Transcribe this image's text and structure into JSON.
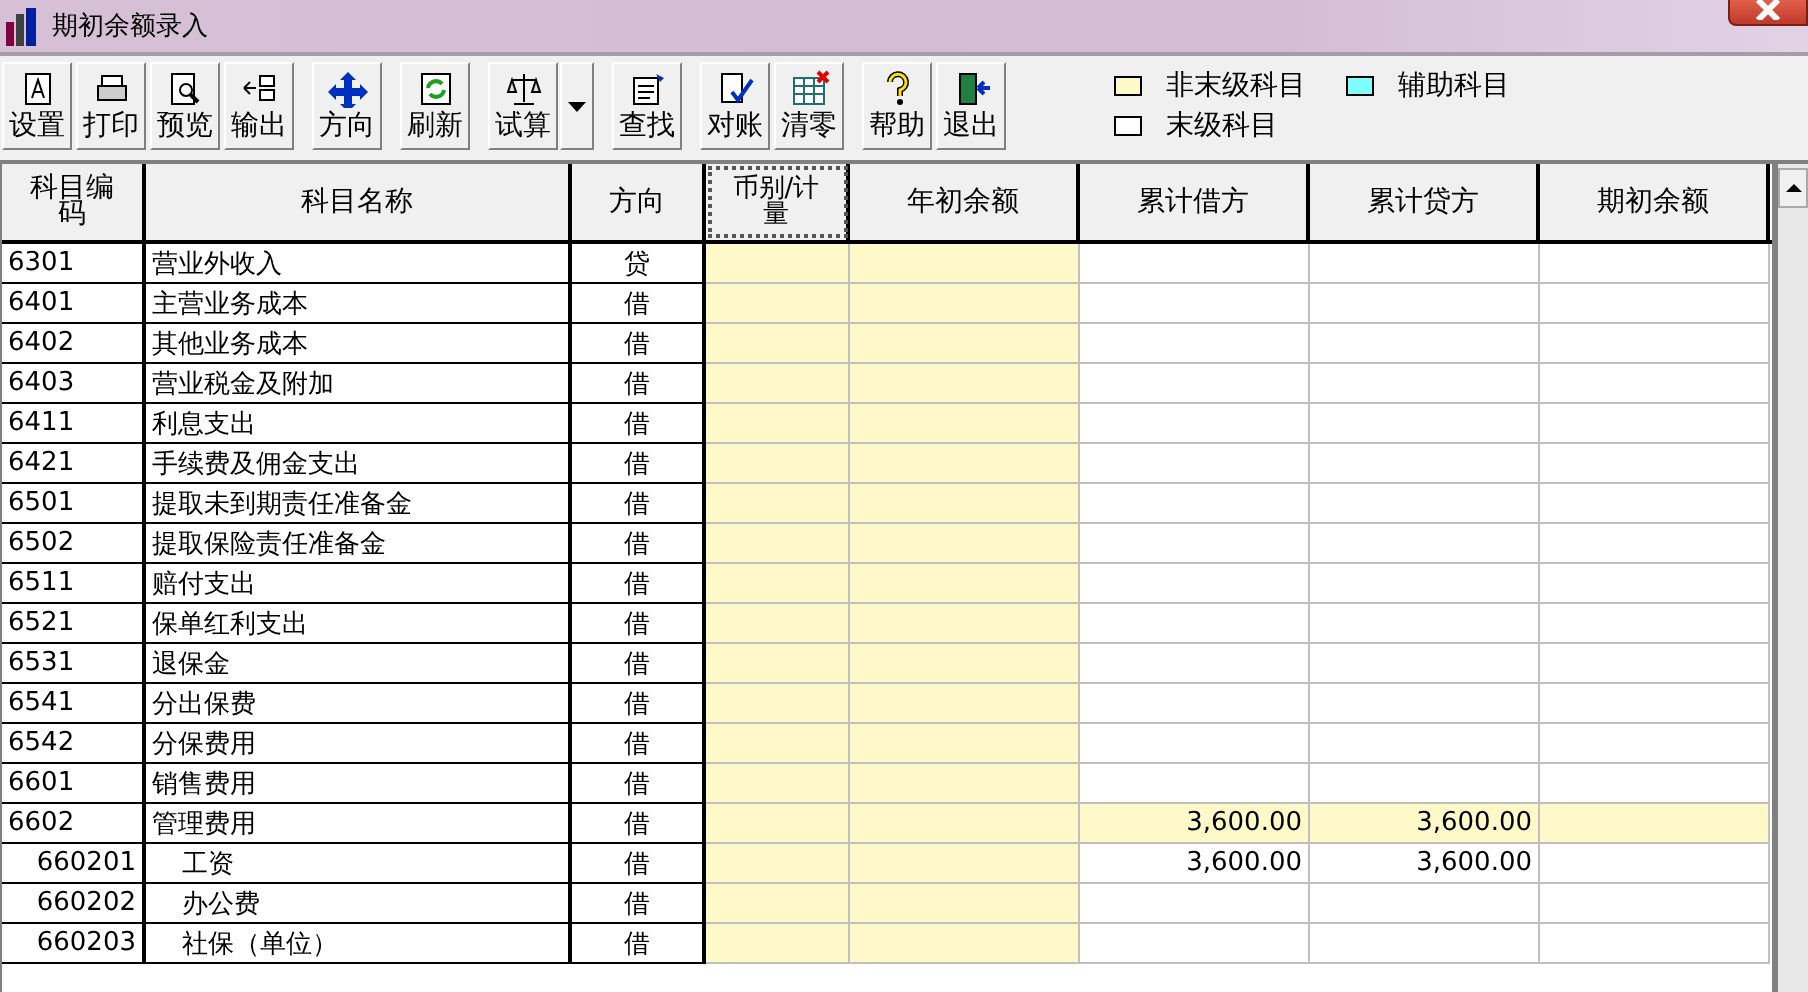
{
  "window": {
    "title": "期初余额录入"
  },
  "toolbar": {
    "groups": [
      {
        "buttons": [
          {
            "label": "设置",
            "kind": "plain"
          },
          {
            "label": "打印",
            "kind": "plain"
          },
          {
            "label": "预览",
            "kind": "plain"
          },
          {
            "label": "输出",
            "kind": "plain"
          }
        ]
      },
      {
        "buttons": [
          {
            "label": "方向",
            "kind": "plain"
          }
        ]
      },
      {
        "buttons": [
          {
            "label": "刷新",
            "kind": "plain"
          }
        ]
      },
      {
        "buttons": [
          {
            "label": "试算",
            "kind": "plain"
          },
          {
            "kind": "dropdown"
          }
        ]
      },
      {
        "buttons": [
          {
            "label": "查找",
            "kind": "plain"
          }
        ]
      },
      {
        "buttons": [
          {
            "label": "对账",
            "kind": "plain"
          },
          {
            "label": "清零",
            "kind": "plain"
          }
        ]
      },
      {
        "buttons": [
          {
            "label": "帮助",
            "kind": "plain"
          },
          {
            "label": "退出",
            "kind": "plain"
          }
        ]
      }
    ]
  },
  "legend": [
    {
      "label": "非末级科目",
      "color": "#fff8c8"
    },
    {
      "label": "辅助科目",
      "color": "#80ffff"
    },
    {
      "label": "末级科目",
      "color": "#ffffff"
    }
  ],
  "table": {
    "columns": [
      "科目编码",
      "科目名称",
      "方向",
      "币别/计量",
      "年初余额",
      "累计借方",
      "累计贷方",
      "期初余额"
    ],
    "rows": [
      {
        "code": "6301",
        "name": "营业外收入",
        "direction": "贷",
        "leaf": true
      },
      {
        "code": "6401",
        "name": "主营业务成本",
        "direction": "借",
        "leaf": true
      },
      {
        "code": "6402",
        "name": "其他业务成本",
        "direction": "借",
        "leaf": true
      },
      {
        "code": "6403",
        "name": "营业税金及附加",
        "direction": "借",
        "leaf": true
      },
      {
        "code": "6411",
        "name": "利息支出",
        "direction": "借",
        "leaf": true
      },
      {
        "code": "6421",
        "name": "手续费及佣金支出",
        "direction": "借",
        "leaf": true
      },
      {
        "code": "6501",
        "name": "提取未到期责任准备金",
        "direction": "借",
        "leaf": true
      },
      {
        "code": "6502",
        "name": "提取保险责任准备金",
        "direction": "借",
        "leaf": true
      },
      {
        "code": "6511",
        "name": "赔付支出",
        "direction": "借",
        "leaf": true
      },
      {
        "code": "6521",
        "name": "保单红利支出",
        "direction": "借",
        "leaf": true
      },
      {
        "code": "6531",
        "name": "退保金",
        "direction": "借",
        "leaf": true
      },
      {
        "code": "6541",
        "name": "分出保费",
        "direction": "借",
        "leaf": true
      },
      {
        "code": "6542",
        "name": "分保费用",
        "direction": "借",
        "leaf": true
      },
      {
        "code": "6601",
        "name": "销售费用",
        "direction": "借",
        "leaf": true
      },
      {
        "code": "6602",
        "name": "管理费用",
        "direction": "借",
        "leaf": false,
        "debit": "3,600.00",
        "credit": "3,600.00",
        "children": [
          {
            "code": "660201",
            "name": "工资",
            "direction": "借",
            "leaf": true,
            "debit": "3,600.00",
            "credit": "3,600.00"
          },
          {
            "code": "660202",
            "name": "办公费",
            "direction": "借",
            "leaf": true
          },
          {
            "code": "660203",
            "name": "社保（单位）",
            "direction": "借",
            "leaf": true
          }
        ]
      }
    ]
  }
}
